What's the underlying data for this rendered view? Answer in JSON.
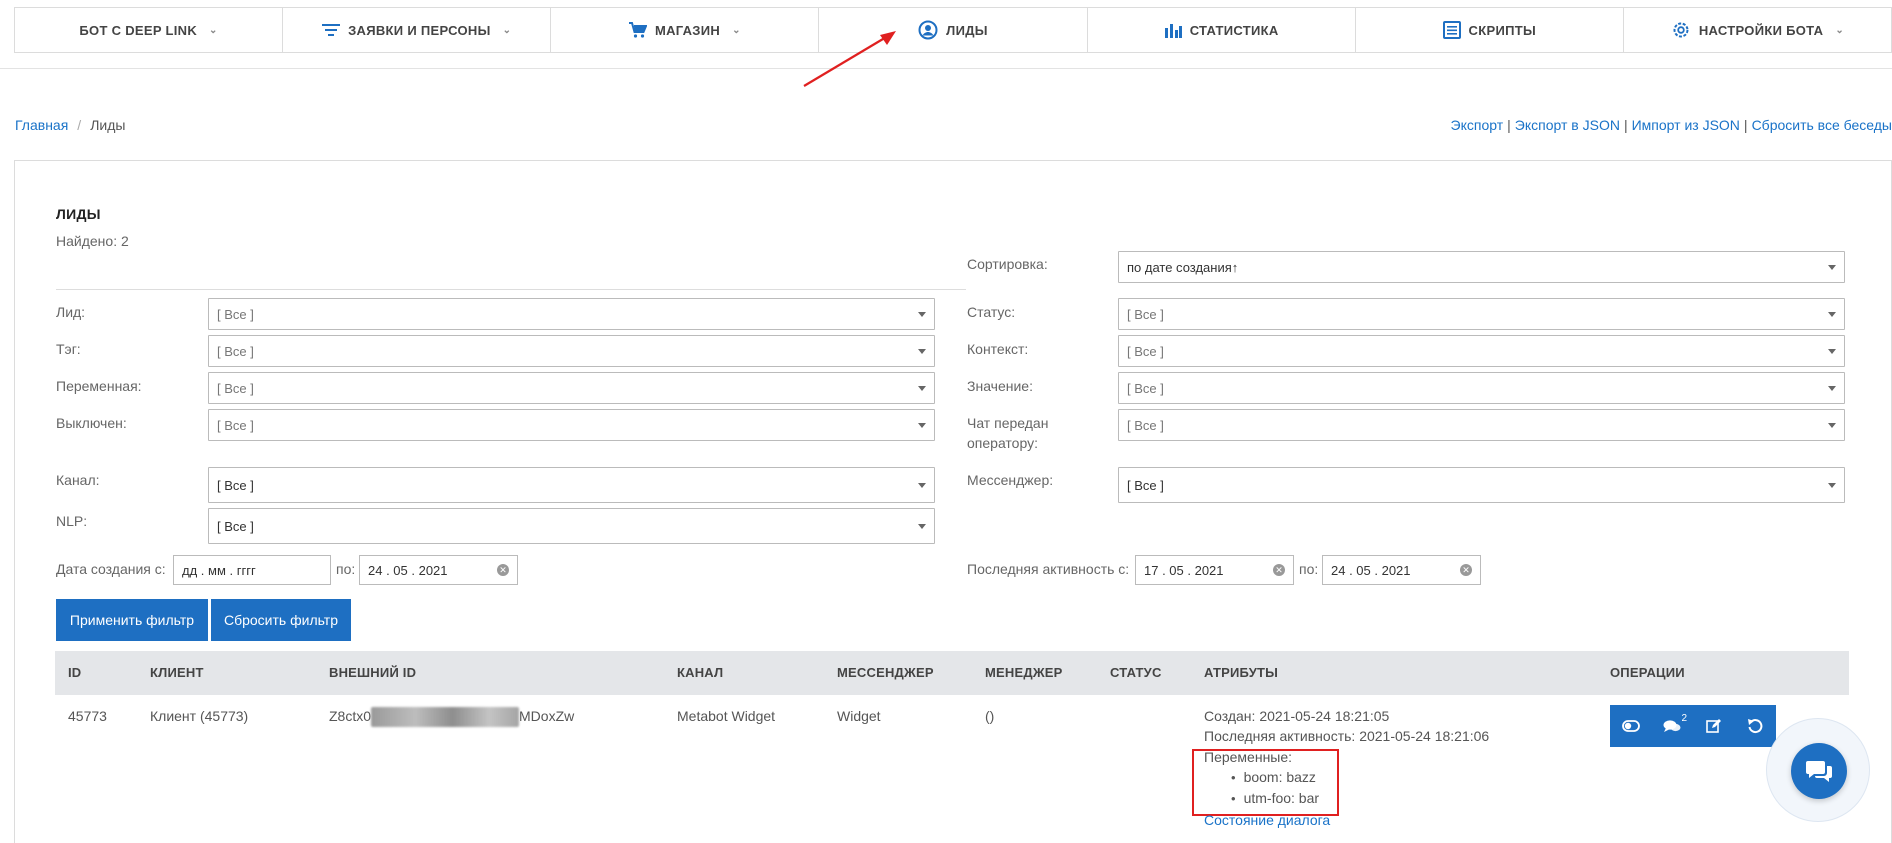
{
  "nav": {
    "items": [
      {
        "label": "БОТ С DEEP LINK",
        "icon": "none",
        "dropdown": true
      },
      {
        "label": "ЗАЯВКИ И ПЕРСОНЫ",
        "icon": "filter-icon",
        "dropdown": true
      },
      {
        "label": "МАГАЗИН",
        "icon": "cart-icon",
        "dropdown": true
      },
      {
        "label": "ЛИДЫ",
        "icon": "user-circle-icon",
        "dropdown": false
      },
      {
        "label": "СТАТИСТИКА",
        "icon": "bar-chart-icon",
        "dropdown": false
      },
      {
        "label": "СКРИПТЫ",
        "icon": "document-icon",
        "dropdown": false
      },
      {
        "label": "НАСТРОЙКИ БОТА",
        "icon": "gear-icon",
        "dropdown": true
      }
    ]
  },
  "breadcrumb": {
    "home": "Главная",
    "current": "Лиды"
  },
  "toplinks": {
    "export": "Экспорт",
    "export_json": "Экспорт в JSON",
    "import_json": "Импорт из JSON",
    "reset_all": "Сбросить все беседы"
  },
  "panel": {
    "title": "ЛИДЫ",
    "found": "Найдено: 2"
  },
  "filters": {
    "sort_label": "Сортировка:",
    "sort_value": "по дате создания↑",
    "lead_label": "Лид:",
    "lead_value": "[ Все ]",
    "tag_label": "Тэг:",
    "tag_value": "[ Все ]",
    "variable_label": "Переменная:",
    "variable_value": "[ Все ]",
    "disabled_label": "Выключен:",
    "disabled_value": "[ Все ]",
    "status_label": "Статус:",
    "status_value": "[ Все ]",
    "context_label": "Контекст:",
    "context_value": "[ Все ]",
    "value_label": "Значение:",
    "value_value": "[ Все ]",
    "operator_label_1": "Чат передан",
    "operator_label_2": "оператору:",
    "operator_value": "[ Все ]",
    "channel_label": "Канал:",
    "channel_value": "[ Все ]",
    "messenger_label": "Мессенджер:",
    "messenger_value": "[ Все ]",
    "nlp_label": "NLP:",
    "nlp_value": "[ Все ]",
    "created_from_label": "Дата создания с:",
    "created_from_value": "дд . мм . гггг",
    "created_to_label": "по:",
    "created_to_value": "24 . 05 . 2021",
    "activity_from_label": "Последняя активность с:",
    "activity_from_value": "17 . 05 . 2021",
    "activity_to_label": "по:",
    "activity_to_value": "24 . 05 . 2021",
    "apply_button": "Применить фильтр",
    "reset_button": "Сбросить фильтр"
  },
  "table": {
    "headers": [
      "ID",
      "КЛИЕНТ",
      "ВНЕШНИЙ ID",
      "КАНАЛ",
      "МЕССЕНДЖЕР",
      "МЕНЕДЖЕР",
      "СТАТУС",
      "АТРИБУТЫ",
      "ОПЕРАЦИИ"
    ],
    "rows": [
      {
        "id": "45773",
        "client": "Клиент (45773)",
        "external_id_prefix": "Z8ctx0",
        "external_id_suffix": "MDoxZw",
        "channel": "Metabot Widget",
        "messenger": "Widget",
        "manager": "()",
        "status": "",
        "created": "Создан: 2021-05-24 18:21:05",
        "last_activity": "Последняя активность: 2021-05-24 18:21:06",
        "variables_label": "Переменные:",
        "variables": [
          "boom: bazz",
          "utm-foo: bar"
        ],
        "dialog_state_link": "Состояние диалога",
        "comments_count": "2"
      }
    ]
  },
  "colors": {
    "primary": "#1e6fc2",
    "link": "#1a73c8",
    "annotation": "#e02020"
  }
}
